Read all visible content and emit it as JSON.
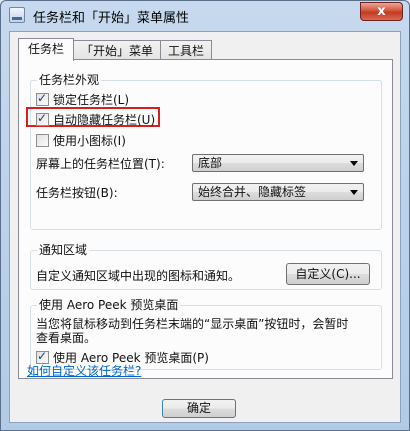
{
  "window": {
    "title": "任务栏和「开始」菜单属性",
    "close_label": "x"
  },
  "tabs": [
    {
      "label": "任务栏",
      "active": true
    },
    {
      "label": "「开始」菜单",
      "active": false
    },
    {
      "label": "工具栏",
      "active": false
    }
  ],
  "appearance": {
    "group_label": "任务栏外观",
    "lock_taskbar": {
      "label": "锁定任务栏(L)",
      "checked": true
    },
    "auto_hide": {
      "label": "自动隐藏任务栏(U)",
      "checked": true
    },
    "small_icons": {
      "label": "使用小图标(I)",
      "checked": false
    },
    "location_label": "屏幕上的任务栏位置(T):",
    "location_value": "底部",
    "buttons_label": "任务栏按钮(B):",
    "buttons_value": "始终合并、隐藏标签"
  },
  "notification": {
    "group_label": "通知区域",
    "description": "自定义通知区域中出现的图标和通知。",
    "customize_button": "自定义(C)..."
  },
  "aero_peek": {
    "group_label": "使用 Aero Peek 预览桌面",
    "description_line1": "当您将鼠标移动到任务栏末端的“显示桌面”按钮时，会暂时",
    "description_line2": "查看桌面。",
    "checkbox": {
      "label": "使用 Aero Peek 预览桌面(P)",
      "checked": true
    }
  },
  "help_link": "如何自定义该任务栏?",
  "ok_button": "确定"
}
